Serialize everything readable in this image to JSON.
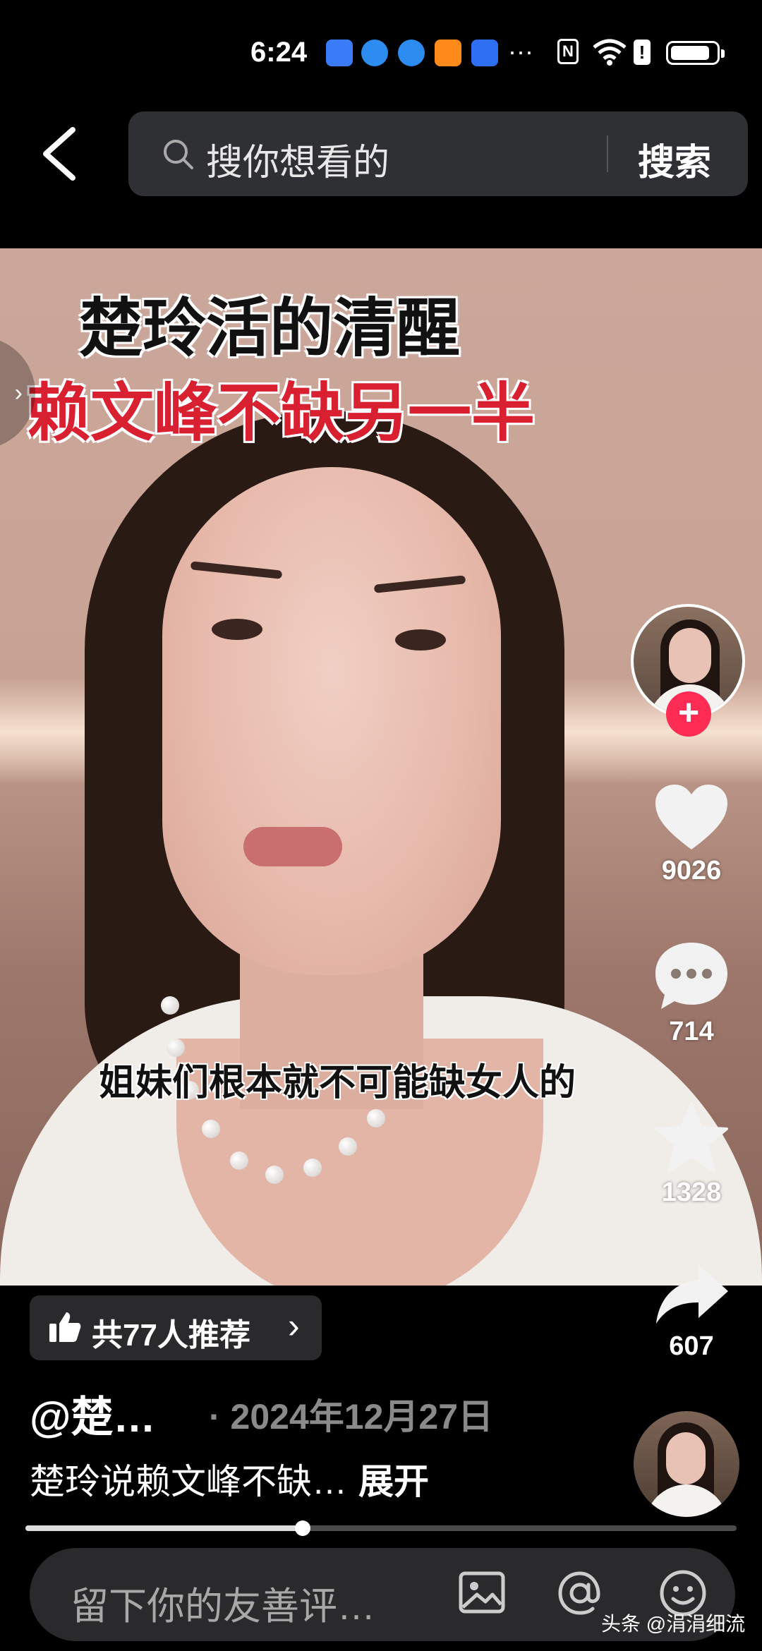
{
  "status": {
    "time": "6:24",
    "more": "···"
  },
  "search": {
    "placeholder": "搜你想看的",
    "button": "搜索"
  },
  "video": {
    "caption_line1": "楚玲活的清醒",
    "caption_line2": "赖文峰不缺另一半",
    "subtitle": "姐妹们根本就不可能缺女人的",
    "side_arrow": "›"
  },
  "rail": {
    "likes": "9026",
    "comments": "714",
    "favorites": "1328",
    "shares": "607",
    "follow_symbol": "+"
  },
  "info": {
    "recommend": "共77人推荐",
    "recommend_chevron": "›",
    "author": "@楚…",
    "date": "· 2024年12月27日",
    "description": "楚玲说赖文峰不缺…",
    "expand": "展开",
    "progress": 0.39
  },
  "comment": {
    "placeholder": "留下你的友善评…"
  },
  "watermark": "头条 @涓涓细流",
  "colors": {
    "accent_red": "#d92031",
    "follow_pink": "#fe2c55"
  },
  "icons": [
    "back-icon",
    "search-icon",
    "heart-icon",
    "comment-icon",
    "star-icon",
    "share-icon",
    "thumbs-up-icon",
    "image-icon",
    "at-icon",
    "emoji-icon"
  ]
}
